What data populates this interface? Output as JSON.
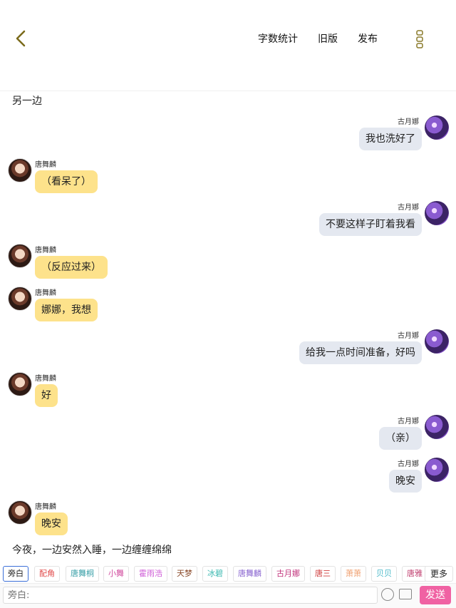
{
  "header": {
    "word_count": "字数统计",
    "old_version": "旧版",
    "publish": "发布"
  },
  "narration_top": "另一边",
  "narration_bottom": "今夜，一边安然入睡，一边缠缠绵绵",
  "messages": [
    {
      "side": "right",
      "name": "古月娜",
      "text": "我也洗好了"
    },
    {
      "side": "left",
      "name": "唐舞麟",
      "text": "（看呆了）"
    },
    {
      "side": "right",
      "name": "古月娜",
      "text": "不要这样子盯着我看"
    },
    {
      "side": "left",
      "name": "唐舞麟",
      "text": "（反应过来）"
    },
    {
      "side": "left",
      "name": "唐舞麟",
      "text": "娜娜，我想"
    },
    {
      "side": "right",
      "name": "古月娜",
      "text": "给我一点时间准备，好吗"
    },
    {
      "side": "left",
      "name": "唐舞麟",
      "text": "好"
    },
    {
      "side": "right",
      "name": "古月娜",
      "text": "（亲）"
    },
    {
      "side": "right",
      "name": "古月娜",
      "text": "晚安"
    },
    {
      "side": "left",
      "name": "唐舞麟",
      "text": "晚安"
    }
  ],
  "role_chips": [
    {
      "label": "旁白",
      "color": "#222222"
    },
    {
      "label": "配角",
      "color": "#e04a4a"
    },
    {
      "label": "唐舞桐",
      "color": "#3aa0a8"
    },
    {
      "label": "小舞",
      "color": "#d24fa0"
    },
    {
      "label": "霍雨浩",
      "color": "#d060d8"
    },
    {
      "label": "天梦",
      "color": "#8a4a2a"
    },
    {
      "label": "冰碧",
      "color": "#3ab8b0"
    },
    {
      "label": "唐舞麟",
      "color": "#8a66d0"
    },
    {
      "label": "古月娜",
      "color": "#c0307a"
    },
    {
      "label": "唐三",
      "color": "#d04040"
    },
    {
      "label": "萧萧",
      "color": "#f0a070"
    },
    {
      "label": "贝贝",
      "color": "#48b8c8"
    },
    {
      "label": "唐雅",
      "color": "#c04070"
    }
  ],
  "more_label": "更多",
  "input": {
    "placeholder": "旁白:"
  },
  "send_label": "发送"
}
